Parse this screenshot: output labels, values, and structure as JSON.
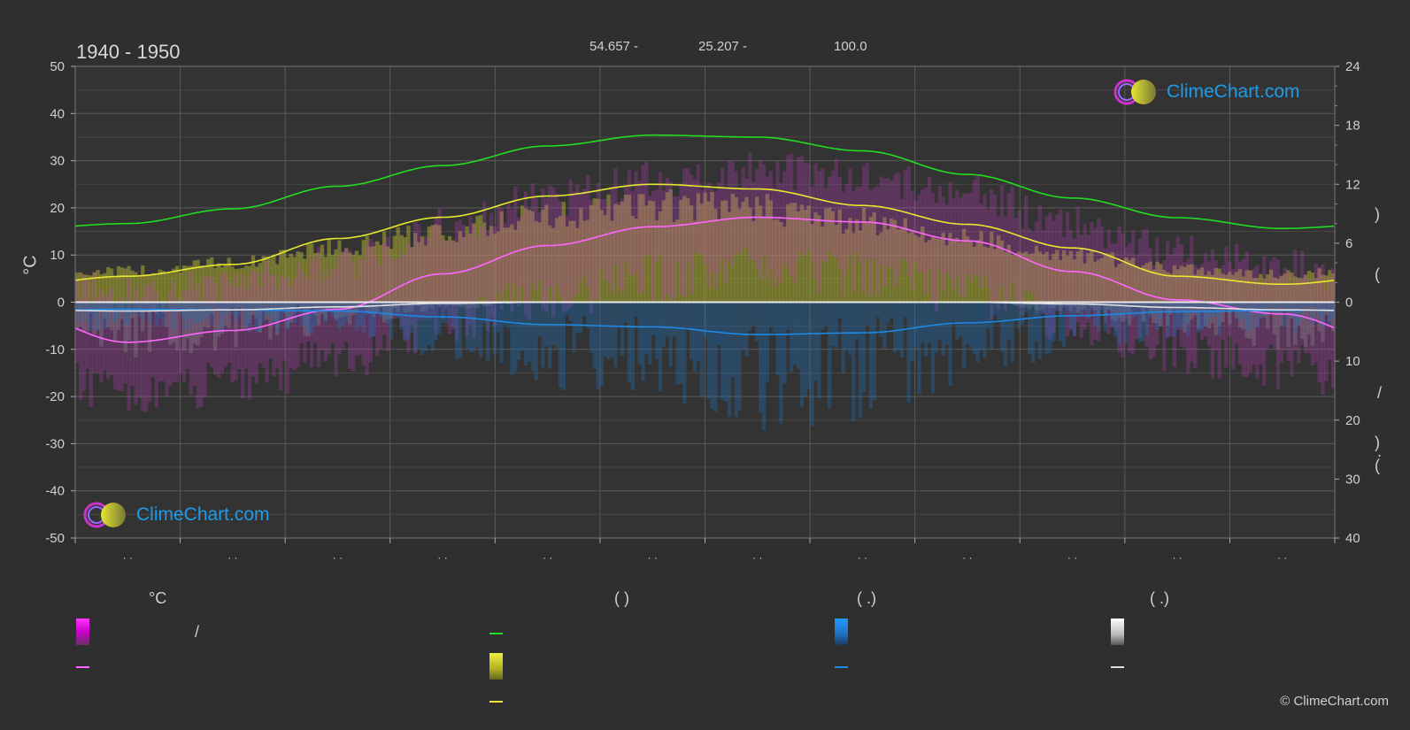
{
  "period": "1940 - 1950",
  "header": {
    "coord1": "54.657 -",
    "coord2": "25.207 -",
    "elevation": "100.0"
  },
  "logo_text": "ClimeChart.com",
  "copyright": "© ClimeChart.com",
  "colors": {
    "background": "#2f2f2f",
    "daylight": "#22dd22",
    "sunshine": "#e8e830",
    "temp_mean": "#ff66ff",
    "rain": "#1e88e5",
    "snow": "#e0e0e0",
    "logo": "#1e9be8"
  },
  "chart_data": {
    "type": "area",
    "left_axis": {
      "label": "°C",
      "ylim": [
        -50,
        50
      ],
      "ticks": [
        "50",
        "40",
        "30",
        "20",
        "10",
        "0",
        "-10",
        "-20",
        "-30",
        "-40",
        "-50"
      ]
    },
    "right_axis_top": {
      "ylim": [
        0,
        24
      ],
      "ticks": [
        "24",
        "18",
        "12",
        "6",
        "0"
      ]
    },
    "right_axis_bottom": {
      "ylim": [
        0,
        40
      ],
      "ticks": [
        "10",
        "20",
        "30",
        "40"
      ]
    },
    "right_labels": [
      ")",
      "(",
      "/",
      ")",
      "(",
      "."
    ],
    "x_tick_labels": [
      "· ·",
      "· ·",
      "· ·",
      "· ·",
      "· ·",
      "· ·",
      "· ·",
      "· ·",
      "· ·",
      "· ·",
      "· ·",
      "· ·"
    ],
    "months": 12,
    "series": [
      {
        "key": "daylight",
        "values": [
          8.0,
          9.5,
          11.8,
          13.9,
          15.9,
          17.0,
          16.8,
          15.4,
          13.0,
          10.6,
          8.6,
          7.5
        ]
      },
      {
        "key": "sunshine_temp_max",
        "values": [
          5.5,
          8.0,
          13.5,
          18.0,
          22.5,
          25.0,
          24.0,
          20.5,
          16.5,
          11.5,
          5.5,
          3.8
        ]
      },
      {
        "key": "temp_mean",
        "values": [
          -8.5,
          -6.0,
          -1.5,
          6.0,
          12.0,
          16.0,
          18.0,
          17.0,
          13.0,
          6.5,
          0.5,
          -2.5
        ]
      },
      {
        "key": "rain",
        "values": [
          1.2,
          1.3,
          1.5,
          2.5,
          3.8,
          4.2,
          5.5,
          5.2,
          3.5,
          2.3,
          1.6,
          1.4
        ]
      },
      {
        "key": "snow",
        "values": [
          1.5,
          1.3,
          0.8,
          0.2,
          0.0,
          0.0,
          0.0,
          0.0,
          0.0,
          0.3,
          0.9,
          1.3
        ]
      }
    ]
  },
  "legend": {
    "col1_header": "°C",
    "col1_slash": "/",
    "col2_header": "(           )",
    "col3_header": "(    .)",
    "col4_header": "(    .)"
  }
}
